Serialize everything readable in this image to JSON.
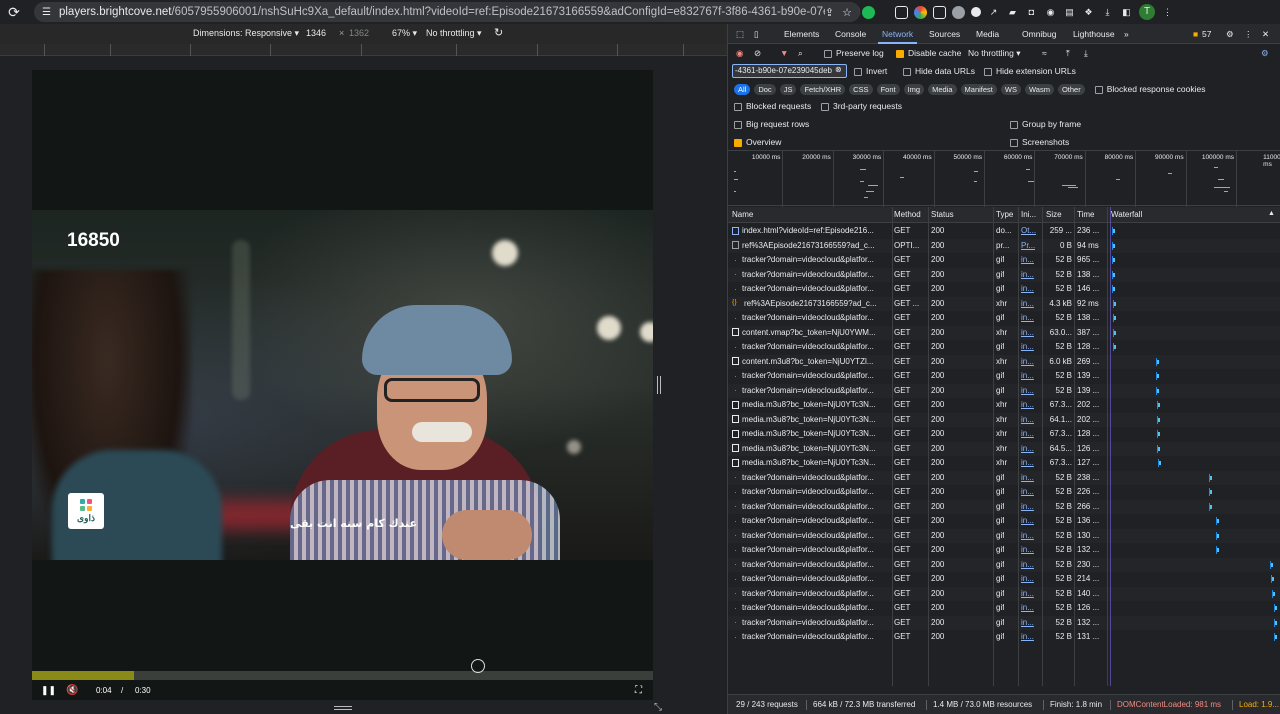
{
  "browser": {
    "url_host": "players.brightcove.net",
    "url_path": "/6057955906001/nshSuHc9Xa_default/index.html?videoId=ref:Episode21673166559&adConfigId=e832767f-3f86-4361-b90e-07e239045d...",
    "avatar_letter": "T"
  },
  "device_toolbar": {
    "dimensions_label": "Dimensions: Responsive",
    "width": "1346",
    "height": "1362",
    "zoom": "67%",
    "throttling": "No throttling"
  },
  "player": {
    "counter": "16850",
    "subtitle": "عندك كام سنه انت بقى",
    "logo_text": "ذاوى",
    "current_time": "0:04",
    "time_separator": "/",
    "duration": "0:30",
    "progress_fraction": 0.165
  },
  "devtools": {
    "tabs": [
      "Elements",
      "Console",
      "Network",
      "Sources",
      "Media",
      "Omnibug",
      "Lighthouse"
    ],
    "active_tab": "Network",
    "issues_count": "57",
    "preserve_log": "Preserve log",
    "disable_cache": "Disable cache",
    "throttling": "No throttling",
    "filter_value": "-4361-b90e-07e239045deb",
    "invert": "Invert",
    "hide_data_urls": "Hide data URLs",
    "hide_extension_urls": "Hide extension URLs",
    "type_filters": [
      "All",
      "Doc",
      "JS",
      "Fetch/XHR",
      "CSS",
      "Font",
      "Img",
      "Media",
      "Manifest",
      "WS",
      "Wasm",
      "Other"
    ],
    "blocked_response_cookies": "Blocked response cookies",
    "blocked_requests": "Blocked requests",
    "third_party_requests": "3rd-party requests",
    "big_request_rows": "Big request rows",
    "group_by_frame": "Group by frame",
    "overview": "Overview",
    "screenshots": "Screenshots",
    "overview_ticks": [
      "10000 ms",
      "20000 ms",
      "30000 ms",
      "40000 ms",
      "50000 ms",
      "60000 ms",
      "70000 ms",
      "80000 ms",
      "90000 ms",
      "100000 ms",
      "110000 ms"
    ],
    "columns": [
      "Name",
      "Method",
      "Status",
      "Type",
      "Ini...",
      "Size",
      "Time",
      "Waterfall"
    ],
    "rows": [
      {
        "icon": "doc",
        "name": "index.html?videoId=ref:Episode216...",
        "method": "GET",
        "status": "200",
        "type": "do...",
        "init": "Ot...",
        "size": "259 ...",
        "time": "236 ...",
        "wf": 0.01
      },
      {
        "icon": "box",
        "name": "ref%3AEpisode21673166559?ad_c...",
        "method": "OPTI...",
        "status": "200",
        "type": "pr...",
        "init": "Pr...",
        "size": "0 B",
        "time": "94 ms",
        "wf": 0.012
      },
      {
        "icon": "dot",
        "name": "tracker?domain=videocloud&platfor...",
        "method": "GET",
        "status": "200",
        "type": "gif",
        "init": "in...",
        "size": "52 B",
        "time": "965 ...",
        "wf": 0.014
      },
      {
        "icon": "dot",
        "name": "tracker?domain=videocloud&platfor...",
        "method": "GET",
        "status": "200",
        "type": "gif",
        "init": "in...",
        "size": "52 B",
        "time": "138 ...",
        "wf": 0.014
      },
      {
        "icon": "dot",
        "name": "tracker?domain=videocloud&platfor...",
        "method": "GET",
        "status": "200",
        "type": "gif",
        "init": "in...",
        "size": "52 B",
        "time": "146 ...",
        "wf": 0.015
      },
      {
        "icon": "fetch",
        "name": "ref%3AEpisode21673166559?ad_c...",
        "method": "GET ...",
        "status": "200",
        "type": "xhr",
        "init": "in...",
        "size": "4.3 kB",
        "time": "92 ms",
        "wf": 0.016
      },
      {
        "icon": "dot",
        "name": "tracker?domain=videocloud&platfor...",
        "method": "GET",
        "status": "200",
        "type": "gif",
        "init": "in...",
        "size": "52 B",
        "time": "138 ...",
        "wf": 0.016
      },
      {
        "icon": "xhr",
        "name": "content.vmap?bc_token=NjU0YWM...",
        "method": "GET",
        "status": "200",
        "type": "xhr",
        "init": "in...",
        "size": "63.0...",
        "time": "387 ...",
        "wf": 0.017
      },
      {
        "icon": "dot",
        "name": "tracker?domain=videocloud&platfor...",
        "method": "GET",
        "status": "200",
        "type": "gif",
        "init": "in...",
        "size": "52 B",
        "time": "128 ...",
        "wf": 0.017
      },
      {
        "icon": "xhr",
        "name": "content.m3u8?bc_token=NjU0YTZl...",
        "method": "GET",
        "status": "200",
        "type": "xhr",
        "init": "in...",
        "size": "6.0 kB",
        "time": "269 ...",
        "wf": 0.28
      },
      {
        "icon": "dot",
        "name": "tracker?domain=videocloud&platfor...",
        "method": "GET",
        "status": "200",
        "type": "gif",
        "init": "in...",
        "size": "52 B",
        "time": "139 ...",
        "wf": 0.28
      },
      {
        "icon": "dot",
        "name": "tracker?domain=videocloud&platfor...",
        "method": "GET",
        "status": "200",
        "type": "gif",
        "init": "in...",
        "size": "52 B",
        "time": "139 ...",
        "wf": 0.28
      },
      {
        "icon": "xhr",
        "name": "media.m3u8?bc_token=NjU0YTc3N...",
        "method": "GET",
        "status": "200",
        "type": "xhr",
        "init": "in...",
        "size": "67.3...",
        "time": "202 ...",
        "wf": 0.282
      },
      {
        "icon": "xhr",
        "name": "media.m3u8?bc_token=NjU0YTc3N...",
        "method": "GET",
        "status": "200",
        "type": "xhr",
        "init": "in...",
        "size": "64.1...",
        "time": "202 ...",
        "wf": 0.283
      },
      {
        "icon": "xhr",
        "name": "media.m3u8?bc_token=NjU0YTc3N...",
        "method": "GET",
        "status": "200",
        "type": "xhr",
        "init": "in...",
        "size": "67.3...",
        "time": "128 ...",
        "wf": 0.285
      },
      {
        "icon": "xhr",
        "name": "media.m3u8?bc_token=NjU0YTc3N...",
        "method": "GET",
        "status": "200",
        "type": "xhr",
        "init": "in...",
        "size": "64.5...",
        "time": "126 ...",
        "wf": 0.286
      },
      {
        "icon": "xhr",
        "name": "media.m3u8?bc_token=NjU0YTc3N...",
        "method": "GET",
        "status": "200",
        "type": "xhr",
        "init": "in...",
        "size": "67.3...",
        "time": "127 ...",
        "wf": 0.29
      },
      {
        "icon": "dot",
        "name": "tracker?domain=videocloud&platfor...",
        "method": "GET",
        "status": "200",
        "type": "gif",
        "init": "in...",
        "size": "52 B",
        "time": "238 ...",
        "wf": 0.595
      },
      {
        "icon": "dot",
        "name": "tracker?domain=videocloud&platfor...",
        "method": "GET",
        "status": "200",
        "type": "gif",
        "init": "in...",
        "size": "52 B",
        "time": "226 ...",
        "wf": 0.597
      },
      {
        "icon": "dot",
        "name": "tracker?domain=videocloud&platfor...",
        "method": "GET",
        "status": "200",
        "type": "gif",
        "init": "in...",
        "size": "52 B",
        "time": "266 ...",
        "wf": 0.598
      },
      {
        "icon": "dot",
        "name": "tracker?domain=videocloud&platfor...",
        "method": "GET",
        "status": "200",
        "type": "gif",
        "init": "in...",
        "size": "52 B",
        "time": "136 ...",
        "wf": 0.64
      },
      {
        "icon": "dot",
        "name": "tracker?domain=videocloud&platfor...",
        "method": "GET",
        "status": "200",
        "type": "gif",
        "init": "in...",
        "size": "52 B",
        "time": "130 ...",
        "wf": 0.64
      },
      {
        "icon": "dot",
        "name": "tracker?domain=videocloud&platfor...",
        "method": "GET",
        "status": "200",
        "type": "gif",
        "init": "in...",
        "size": "52 B",
        "time": "132 ...",
        "wf": 0.64
      },
      {
        "icon": "dot",
        "name": "tracker?domain=videocloud&platfor...",
        "method": "GET",
        "status": "200",
        "type": "gif",
        "init": "in...",
        "size": "52 B",
        "time": "230 ...",
        "wf": 0.965
      },
      {
        "icon": "dot",
        "name": "tracker?domain=videocloud&platfor...",
        "method": "GET",
        "status": "200",
        "type": "gif",
        "init": "in...",
        "size": "52 B",
        "time": "214 ...",
        "wf": 0.967
      },
      {
        "icon": "dot",
        "name": "tracker?domain=videocloud&platfor...",
        "method": "GET",
        "status": "200",
        "type": "gif",
        "init": "in...",
        "size": "52 B",
        "time": "140 ...",
        "wf": 0.975
      },
      {
        "icon": "dot",
        "name": "tracker?domain=videocloud&platfor...",
        "method": "GET",
        "status": "200",
        "type": "gif",
        "init": "in...",
        "size": "52 B",
        "time": "126 ...",
        "wf": 0.985
      },
      {
        "icon": "dot",
        "name": "tracker?domain=videocloud&platfor...",
        "method": "GET",
        "status": "200",
        "type": "gif",
        "init": "in...",
        "size": "52 B",
        "time": "132 ...",
        "wf": 0.988
      },
      {
        "icon": "dot",
        "name": "tracker?domain=videocloud&platfor...",
        "method": "GET",
        "status": "200",
        "type": "gif",
        "init": "in...",
        "size": "52 B",
        "time": "131 ...",
        "wf": 0.99
      }
    ],
    "status_bar": {
      "requests": "29 / 243 requests",
      "transferred": "664 kB / 72.3 MB transferred",
      "resources": "1.4 MB / 73.0 MB resources",
      "finish": "Finish: 1.8 min",
      "dcl": "DOMContentLoaded: 981 ms",
      "load": "Load: 1.9..."
    },
    "colors": {
      "accent": "#8ab4f8",
      "dcl": "#f28b82",
      "load": "#f9ab00",
      "waterfall": "#4fc3f7"
    }
  }
}
